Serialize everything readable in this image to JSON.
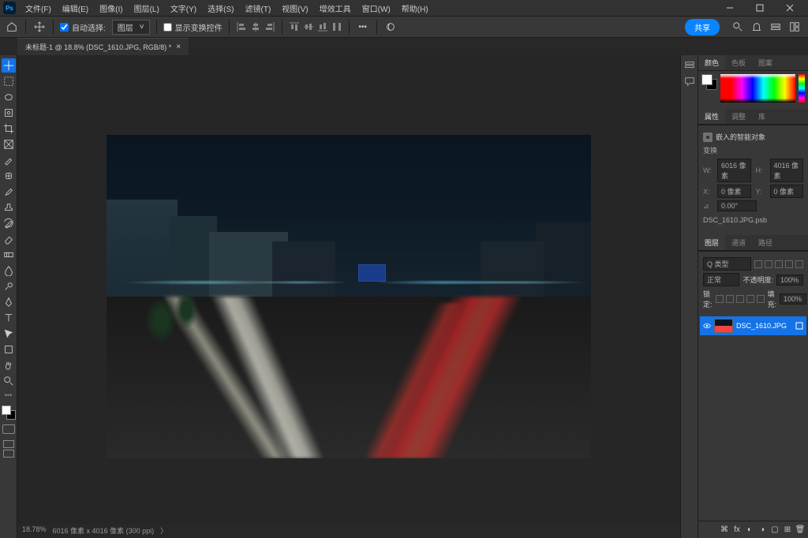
{
  "app": {
    "logo": "Ps"
  },
  "menu": {
    "file": "文件(F)",
    "edit": "编辑(E)",
    "image": "图像(I)",
    "layer": "图层(L)",
    "type": "文字(Y)",
    "select": "选择(S)",
    "filter": "滤镜(T)",
    "view": "视图(V)",
    "plugin": "增效工具",
    "window": "窗口(W)",
    "help": "帮助(H)"
  },
  "options": {
    "autoSelect": "自动选择:",
    "autoSelectTarget": "图层",
    "showTransform": "显示变换控件",
    "share": "共享"
  },
  "document": {
    "tab": "未标题-1 @ 18.8% (DSC_1610.JPG, RGB/8) *",
    "zoom": "18.78%",
    "dimensions": "6016 像素 x 4016 像素 (300 ppi)"
  },
  "panels": {
    "color": {
      "tab1": "颜色",
      "tab2": "色板",
      "tab3": "图案"
    },
    "properties": {
      "tab1": "属性",
      "tab2": "调整",
      "tab3": "库",
      "smartObject": "嵌入的智能对象",
      "transform": "变换",
      "wLabel": "W:",
      "wVal": "6016 像素",
      "hLabel": "H:",
      "hVal": "4016 像素",
      "xLabel": "X:",
      "xVal": "0 像素",
      "yLabel": "Y:",
      "yVal": "0 像素",
      "angleLabel": "⊿",
      "angleVal": "0.00°",
      "filename": "DSC_1610.JPG.psb"
    },
    "layers": {
      "tab1": "图层",
      "tab2": "通道",
      "tab3": "路径",
      "kind": "Q 类型",
      "blend": "正常",
      "opacityLabel": "不透明度:",
      "opacity": "100%",
      "lockLabel": "锁定:",
      "fillLabel": "填充:",
      "fill": "100%",
      "layer1": "DSC_1610.JPG"
    }
  }
}
